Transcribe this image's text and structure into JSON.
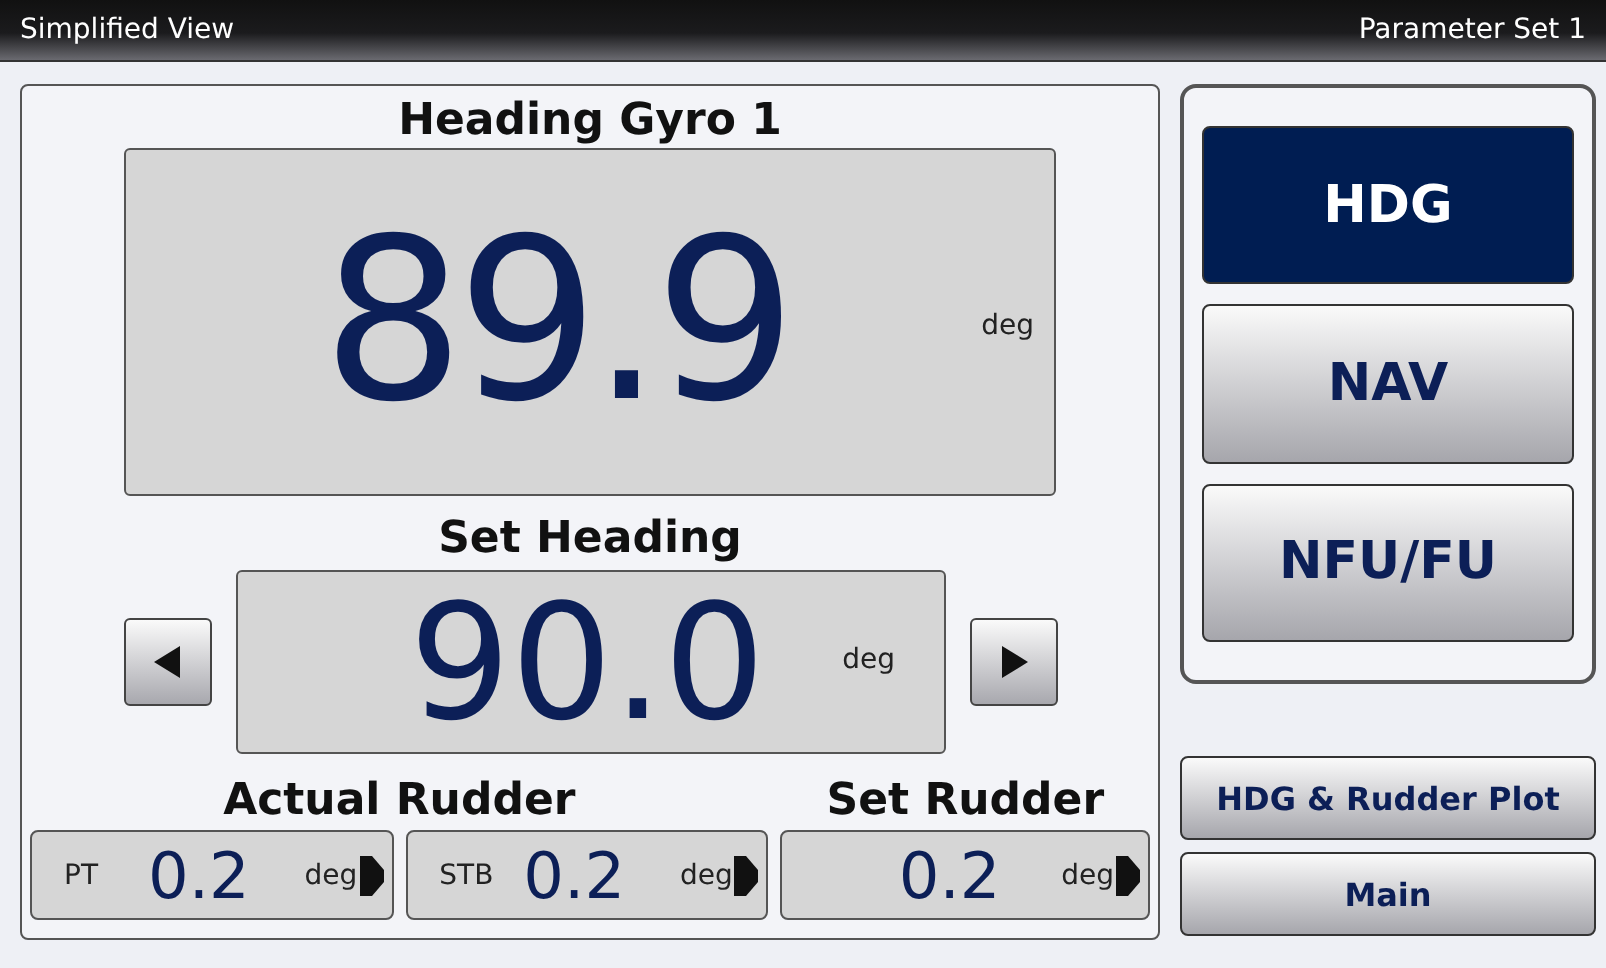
{
  "title_bar": {
    "title": "Simplified View",
    "parameter_set": "Parameter Set 1"
  },
  "heading": {
    "label": "Heading Gyro 1",
    "value": "89.9",
    "unit": "deg"
  },
  "set_heading": {
    "label": "Set Heading",
    "value": "90.0",
    "unit": "deg"
  },
  "rudder_groups": [
    {
      "label": "Actual Rudder",
      "readouts": [
        {
          "side": "PT",
          "value": "0.2",
          "unit": "deg"
        },
        {
          "side": "STB",
          "value": "0.2",
          "unit": "deg"
        }
      ]
    },
    {
      "label": "Set Rudder",
      "readouts": [
        {
          "value": "0.2",
          "unit": "deg"
        }
      ]
    }
  ],
  "modes": [
    {
      "label": "HDG",
      "selected": true
    },
    {
      "label": "NAV",
      "selected": false
    },
    {
      "label": "NFU/FU",
      "selected": false
    }
  ],
  "nav_buttons": [
    "HDG & Rudder Plot",
    "Main"
  ]
}
